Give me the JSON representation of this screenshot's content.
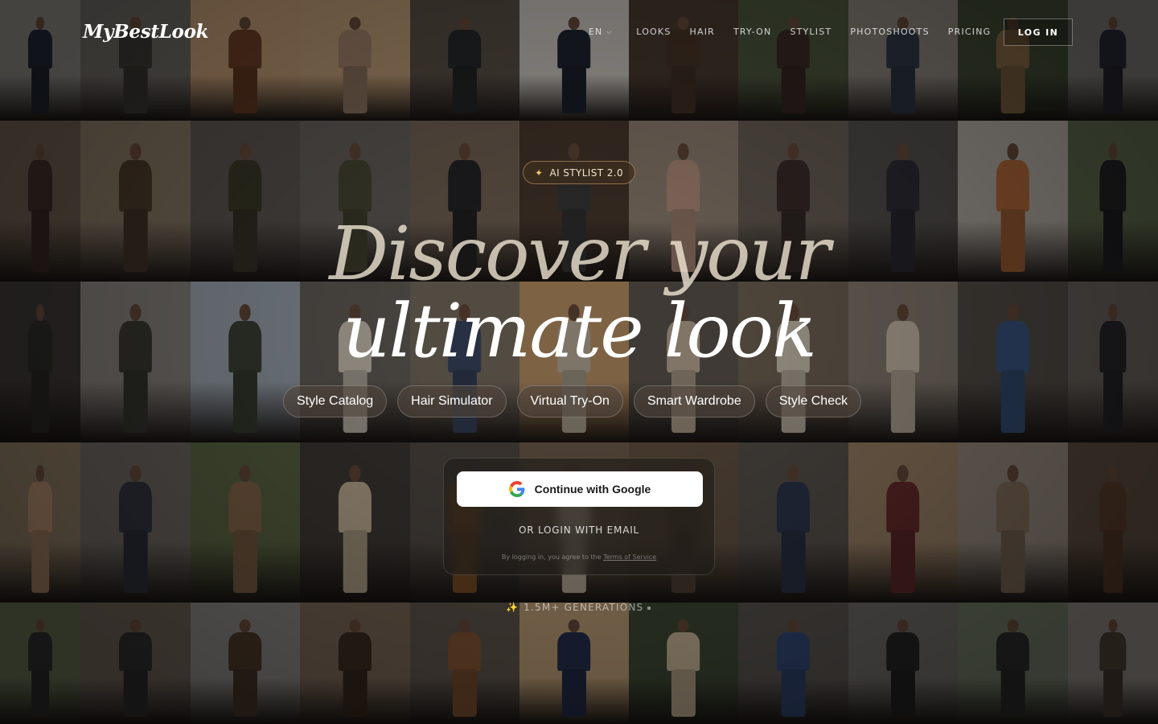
{
  "brand": {
    "name": "MyBestLook"
  },
  "nav": {
    "language": "EN",
    "items": [
      "LOOKS",
      "HAIR",
      "TRY-ON",
      "STYLIST",
      "PHOTOSHOOTS",
      "PRICING"
    ],
    "login_label": "LOG IN"
  },
  "hero": {
    "badge": "AI STYLIST 2.0",
    "title_line1": "Discover your",
    "title_line2": "ultimate look",
    "features": [
      "Style Catalog",
      "Hair Simulator",
      "Virtual Try-On",
      "Smart Wardrobe",
      "Style Check"
    ]
  },
  "auth": {
    "google_label": "Continue with Google",
    "email_label": "OR LOGIN WITH EMAIL",
    "terms_prefix": "By logging in, you agree to the",
    "terms_link": "Terms of Service"
  },
  "stats": {
    "generations": "1.5M+ GENERATIONS"
  },
  "colors": {
    "accent": "#f0c46a",
    "background": "#1b1714",
    "card": "#1e1b19"
  }
}
